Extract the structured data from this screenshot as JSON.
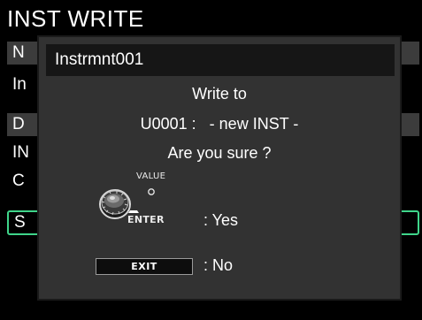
{
  "background": {
    "title": "INST WRITE",
    "rows": [
      {
        "text": "N"
      },
      {
        "text": "In"
      },
      {
        "text": "D"
      },
      {
        "text": "IN"
      },
      {
        "text": "C"
      },
      {
        "text": "S"
      }
    ]
  },
  "dialog": {
    "title": "Instrmnt001",
    "line1": "Write to",
    "line2": "U0001 :   - new INST -",
    "line3": "Are you sure ?",
    "value_label": "VALUE",
    "enter_label": "ENTER",
    "yes_label": ": Yes",
    "exit_label": "EXIT",
    "no_label": ": No"
  },
  "colors": {
    "accent": "#3fd58a",
    "dialog_bg": "#323232",
    "title_bar_bg": "#161616"
  },
  "icons": {
    "knob": "value-knob-icon",
    "enter": "enter-button-icon"
  }
}
